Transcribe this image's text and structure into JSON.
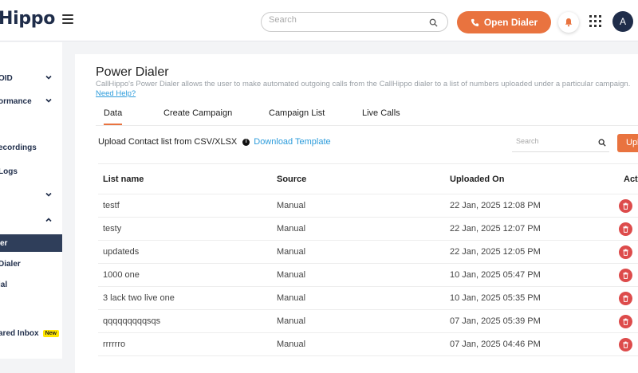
{
  "brand": {
    "logo_text": "Hippo"
  },
  "header": {
    "search_placeholder": "Search",
    "open_dialer_label": "Open Dialer",
    "avatar_initial": "A"
  },
  "sidebar": {
    "items": [
      {
        "label": "OID",
        "chevron": "down"
      },
      {
        "label": "ormance",
        "chevron": "down"
      },
      {
        "label": "ecordings"
      },
      {
        "label": "Logs"
      },
      {
        "label": "",
        "chevron": "down"
      },
      {
        "label": "",
        "chevron": "up"
      },
      {
        "label": "er",
        "active": true
      },
      {
        "label": "Dialer"
      },
      {
        "label": "ial"
      },
      {
        "label": "ared Inbox",
        "badge": "New"
      }
    ]
  },
  "page": {
    "title": "Power Dialer",
    "description": "CallHippo's Power Dialer allows the user to make automated outgoing calls from the CallHippo dialer to a list of numbers uploaded under a particular campaign.",
    "help_link": "Need Help?"
  },
  "tabs": [
    {
      "label": "Data",
      "active": true
    },
    {
      "label": "Create Campaign"
    },
    {
      "label": "Campaign List"
    },
    {
      "label": "Live Calls"
    }
  ],
  "upload": {
    "label": "Upload Contact list from CSV/XLSX",
    "info_glyph": "i",
    "template_link": "Download Template",
    "search_placeholder": "Search",
    "button_label": "Upload"
  },
  "table": {
    "columns": [
      "List name",
      "Source",
      "Uploaded On",
      "Action"
    ],
    "rows": [
      {
        "name": "testf",
        "source": "Manual",
        "uploaded": "22 Jan, 2025 12:08 PM"
      },
      {
        "name": "testy",
        "source": "Manual",
        "uploaded": "22 Jan, 2025 12:07 PM"
      },
      {
        "name": "updateds",
        "source": "Manual",
        "uploaded": "22 Jan, 2025 12:05 PM"
      },
      {
        "name": "1000 one",
        "source": "Manual",
        "uploaded": "10 Jan, 2025 05:47 PM"
      },
      {
        "name": "3 lack two live one",
        "source": "Manual",
        "uploaded": "10 Jan, 2025 05:35 PM"
      },
      {
        "name": "qqqqqqqqqsqs",
        "source": "Manual",
        "uploaded": "07 Jan, 2025 05:39 PM"
      },
      {
        "name": "rrrrrro",
        "source": "Manual",
        "uploaded": "07 Jan, 2025 04:46 PM"
      }
    ]
  },
  "colors": {
    "accent": "#e9733f",
    "navy": "#1f2d4a",
    "link": "#2d9cdb",
    "delete": "#dd4b4b"
  }
}
